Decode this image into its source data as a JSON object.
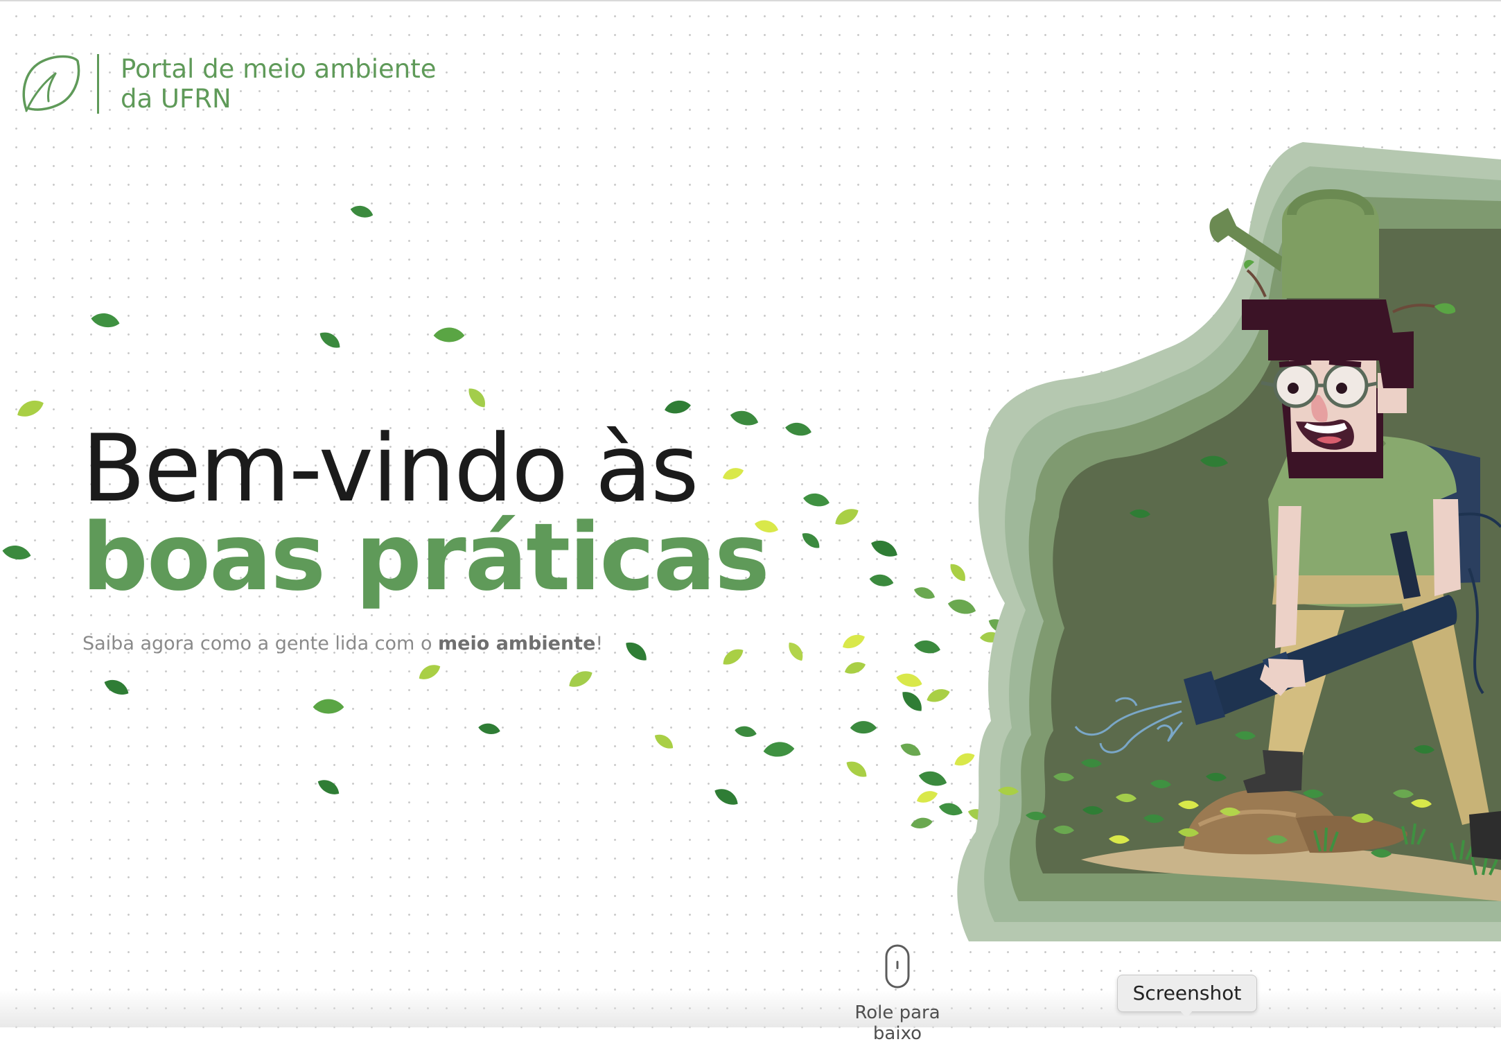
{
  "brand": {
    "line1": "Portal de meio ambiente",
    "line2": "da UFRN",
    "logo_icon": "leaf-icon"
  },
  "hero": {
    "title_line1": "Bem-vindo às",
    "title_line2": "boas práticas",
    "subtitle_before": "Saiba agora como a gente lida com o ",
    "subtitle_bold": "meio ambiente",
    "subtitle_after": "!"
  },
  "scroll": {
    "label": "Role para baixo",
    "icon": "mouse-scroll-icon"
  },
  "tooltip": {
    "label": "Screenshot"
  },
  "illustration": {
    "description_icon": "gardener-leaf-blower-illustration"
  },
  "colors": {
    "brand_green": "#5f9a59",
    "title_dark": "#1b1b1b",
    "subtitle_gray": "#8a8a8a",
    "leaf_dark": "#3f8f3f",
    "leaf_light": "#b7d64f"
  }
}
